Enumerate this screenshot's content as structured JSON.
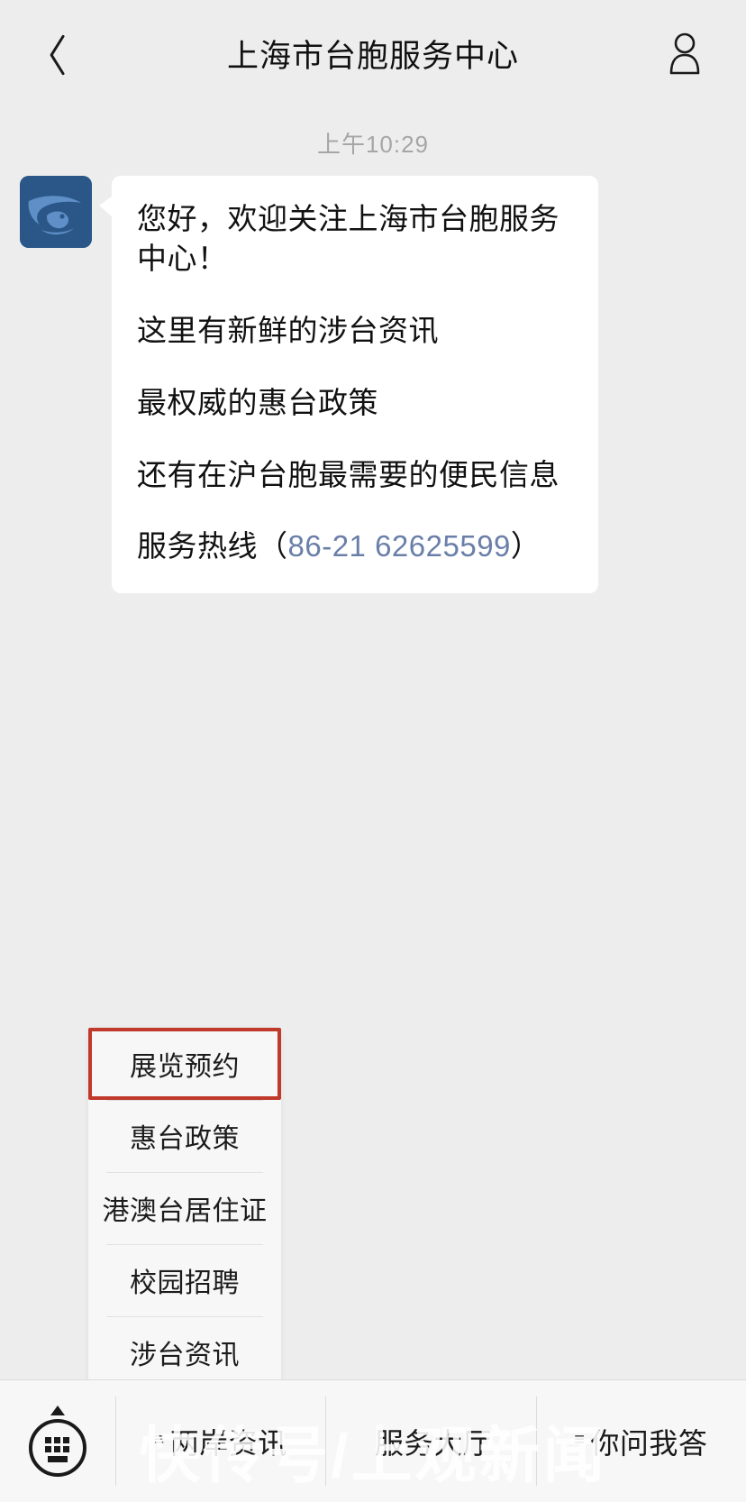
{
  "header": {
    "title": "上海市台胞服务中心",
    "back_icon": "chevron-left-icon",
    "profile_icon": "person-icon"
  },
  "chat": {
    "timestamp": "上午10:29",
    "message": {
      "avatar_icon": "account-avatar-bird-logo",
      "lines": [
        "您好，欢迎关注上海市台胞服务中心！",
        "这里有新鲜的涉台资讯",
        "最权威的惠台政策",
        "还有在沪台胞最需要的便民信息"
      ],
      "hotline_prefix": "服务热线（",
      "hotline_number": "86-21 62625599",
      "hotline_suffix": "）",
      "link_color": "#6a7fa8"
    }
  },
  "menu_panel": {
    "items": [
      {
        "label": "展览预约",
        "highlighted": true
      },
      {
        "label": "惠台政策",
        "highlighted": false
      },
      {
        "label": "港澳台居住证",
        "highlighted": false
      },
      {
        "label": "校园招聘",
        "highlighted": false
      },
      {
        "label": "涉台资讯",
        "highlighted": false
      }
    ],
    "highlight_color": "#c0392b"
  },
  "bottom_bar": {
    "keyboard_icon": "keyboard-toggle-icon",
    "tabs": [
      {
        "mark": "≡",
        "label": "两岸资讯"
      },
      {
        "mark": "",
        "label": "服务大厅"
      },
      {
        "mark": "≡",
        "label": "你问我答"
      }
    ]
  },
  "watermark": {
    "text": "快传号/上观新闻"
  }
}
